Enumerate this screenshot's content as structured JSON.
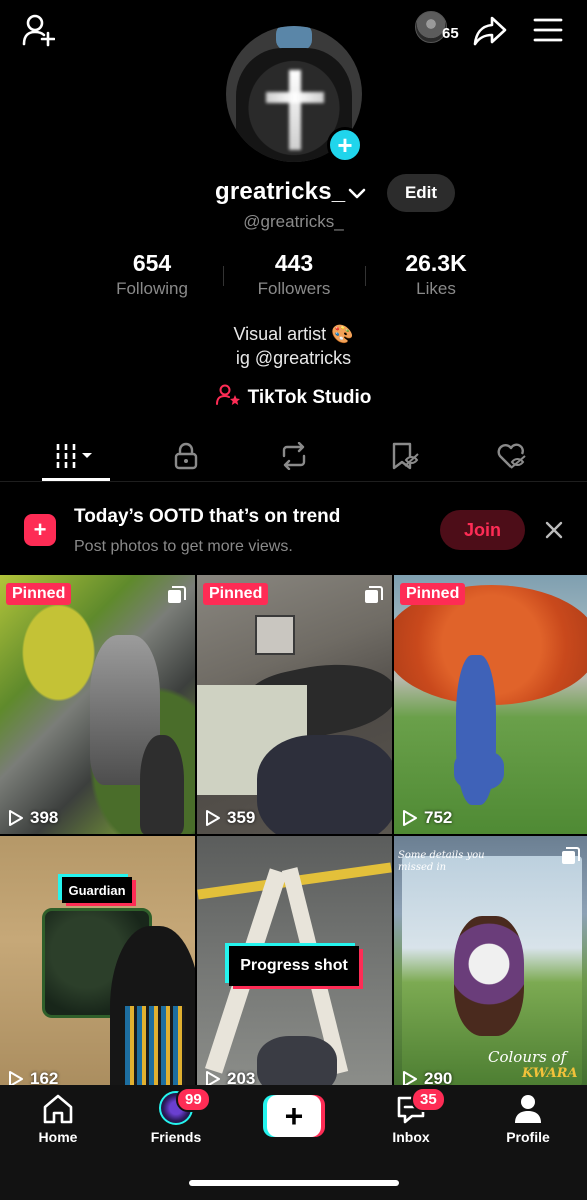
{
  "profile": {
    "username": "greatricks_",
    "handle": "@greatricks_",
    "edit_label": "Edit",
    "profile_viewers_count": "65",
    "bio_line1": "Visual artist 🎨",
    "bio_line2": "ig @greatricks",
    "studio_label": "TikTok Studio"
  },
  "stats": [
    {
      "value": "654",
      "label": "Following"
    },
    {
      "value": "443",
      "label": "Followers"
    },
    {
      "value": "26.3K",
      "label": "Likes"
    }
  ],
  "tabs": [
    {
      "icon": "videos-grid-icon",
      "active": true
    },
    {
      "icon": "lock-icon"
    },
    {
      "icon": "repost-icon"
    },
    {
      "icon": "favorites-icon"
    },
    {
      "icon": "liked-hidden-icon"
    }
  ],
  "banner": {
    "title": "Today’s OOTD that’s on trend",
    "subtitle": "Post photos to get more views.",
    "join_label": "Join"
  },
  "videos": [
    {
      "pinned_label": "Pinned",
      "views": "398"
    },
    {
      "pinned_label": "Pinned",
      "views": "359"
    },
    {
      "pinned_label": "Pinned",
      "views": "752"
    },
    {
      "overlay": "Guardian",
      "views": "162"
    },
    {
      "overlay": "Progress shot",
      "views": "203"
    },
    {
      "caption_top": "Some details you missed in",
      "caption_bottom1": "Colours of",
      "caption_bottom2": "KWARA",
      "views": "290"
    }
  ],
  "nav": {
    "home": "Home",
    "friends": "Friends",
    "friends_badge": "99",
    "inbox": "Inbox",
    "inbox_badge": "35",
    "profile": "Profile"
  },
  "colors": {
    "accent_red": "#fe2c55",
    "accent_cyan": "#25f4ee",
    "plus_badge": "#20d5ec",
    "background": "#000000"
  }
}
